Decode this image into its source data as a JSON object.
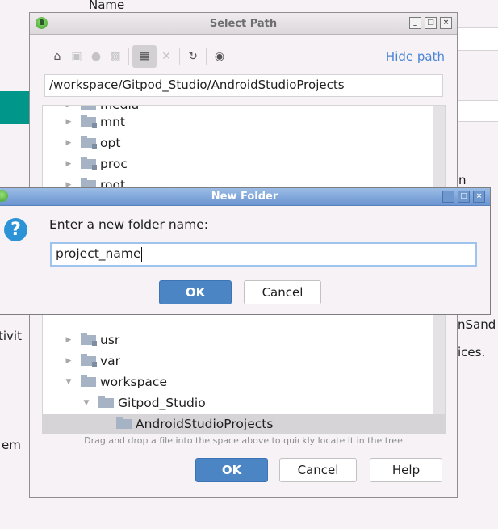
{
  "background": {
    "column_header": "Name",
    "fragments": [
      "n",
      "tivit",
      "nSand",
      "ices.",
      "em"
    ]
  },
  "select_path": {
    "title": "Select Path",
    "window_buttons": [
      "_",
      "□",
      "×"
    ],
    "toolbar": {
      "icons": [
        "home-icon",
        "desktop-icon",
        "project-icon",
        "module-icon",
        "new-folder-icon",
        "delete-icon",
        "refresh-icon",
        "show-hidden-icon"
      ],
      "hide_path_label": "Hide path"
    },
    "path_value": "/workspace/Gitpod_Studio/AndroidStudioProjects",
    "tree": [
      {
        "label": "media",
        "indent": 0,
        "expanded": false,
        "link": false
      },
      {
        "label": "mnt",
        "indent": 0,
        "expanded": false,
        "link": true
      },
      {
        "label": "opt",
        "indent": 0,
        "expanded": false,
        "link": true
      },
      {
        "label": "proc",
        "indent": 0,
        "expanded": false,
        "link": true
      },
      {
        "label": "root",
        "indent": 0,
        "expanded": false,
        "link": false
      },
      {
        "label": "usr",
        "indent": 0,
        "expanded": false,
        "link": true
      },
      {
        "label": "var",
        "indent": 0,
        "expanded": false,
        "link": true
      },
      {
        "label": "workspace",
        "indent": 0,
        "expanded": true,
        "link": false
      },
      {
        "label": "Gitpod_Studio",
        "indent": 1,
        "expanded": true,
        "link": false
      },
      {
        "label": "AndroidStudioProjects",
        "indent": 2,
        "expanded": null,
        "link": false,
        "selected": true
      }
    ],
    "hint": "Drag and drop a file into the space above to quickly locate it in the tree",
    "buttons": {
      "ok": "OK",
      "cancel": "Cancel",
      "help": "Help"
    }
  },
  "new_folder": {
    "title": "New Folder",
    "window_buttons": [
      "_",
      "□",
      "×"
    ],
    "prompt": "Enter a new folder name:",
    "input_value": "project_name",
    "buttons": {
      "ok": "OK",
      "cancel": "Cancel"
    },
    "icon": "?"
  }
}
